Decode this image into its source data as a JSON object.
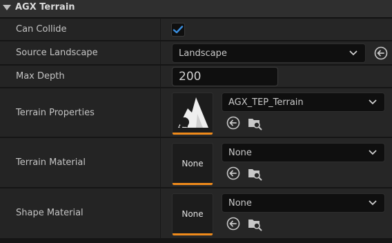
{
  "category": {
    "title": "AGX Terrain",
    "arrow_icon": "triangle-down-icon"
  },
  "colors": {
    "accent_orange": "#f08a1a",
    "checkbox_blue": "#3b8fe0",
    "panel_bg": "#242424"
  },
  "rows": {
    "can_collide": {
      "label": "Can Collide",
      "checked": true
    },
    "source_landscape": {
      "label": "Source Landscape",
      "value": "Landscape",
      "icon": "use-selected-arrow-icon"
    },
    "max_depth": {
      "label": "Max Depth",
      "value": "200"
    },
    "terrain_properties": {
      "label": "Terrain Properties",
      "asset": "AGX_TEP_Terrain",
      "thumbnail_icon": "terrain-properties-asset-icon",
      "buttons": [
        "use-selected-arrow-icon",
        "browse-asset-icon"
      ]
    },
    "terrain_material": {
      "label": "Terrain Material",
      "asset": "None",
      "thumbnail_text": "None",
      "buttons": [
        "use-selected-arrow-icon",
        "browse-asset-icon"
      ]
    },
    "shape_material": {
      "label": "Shape Material",
      "asset": "None",
      "thumbnail_text": "None",
      "buttons": [
        "use-selected-arrow-icon",
        "browse-asset-icon"
      ]
    }
  }
}
